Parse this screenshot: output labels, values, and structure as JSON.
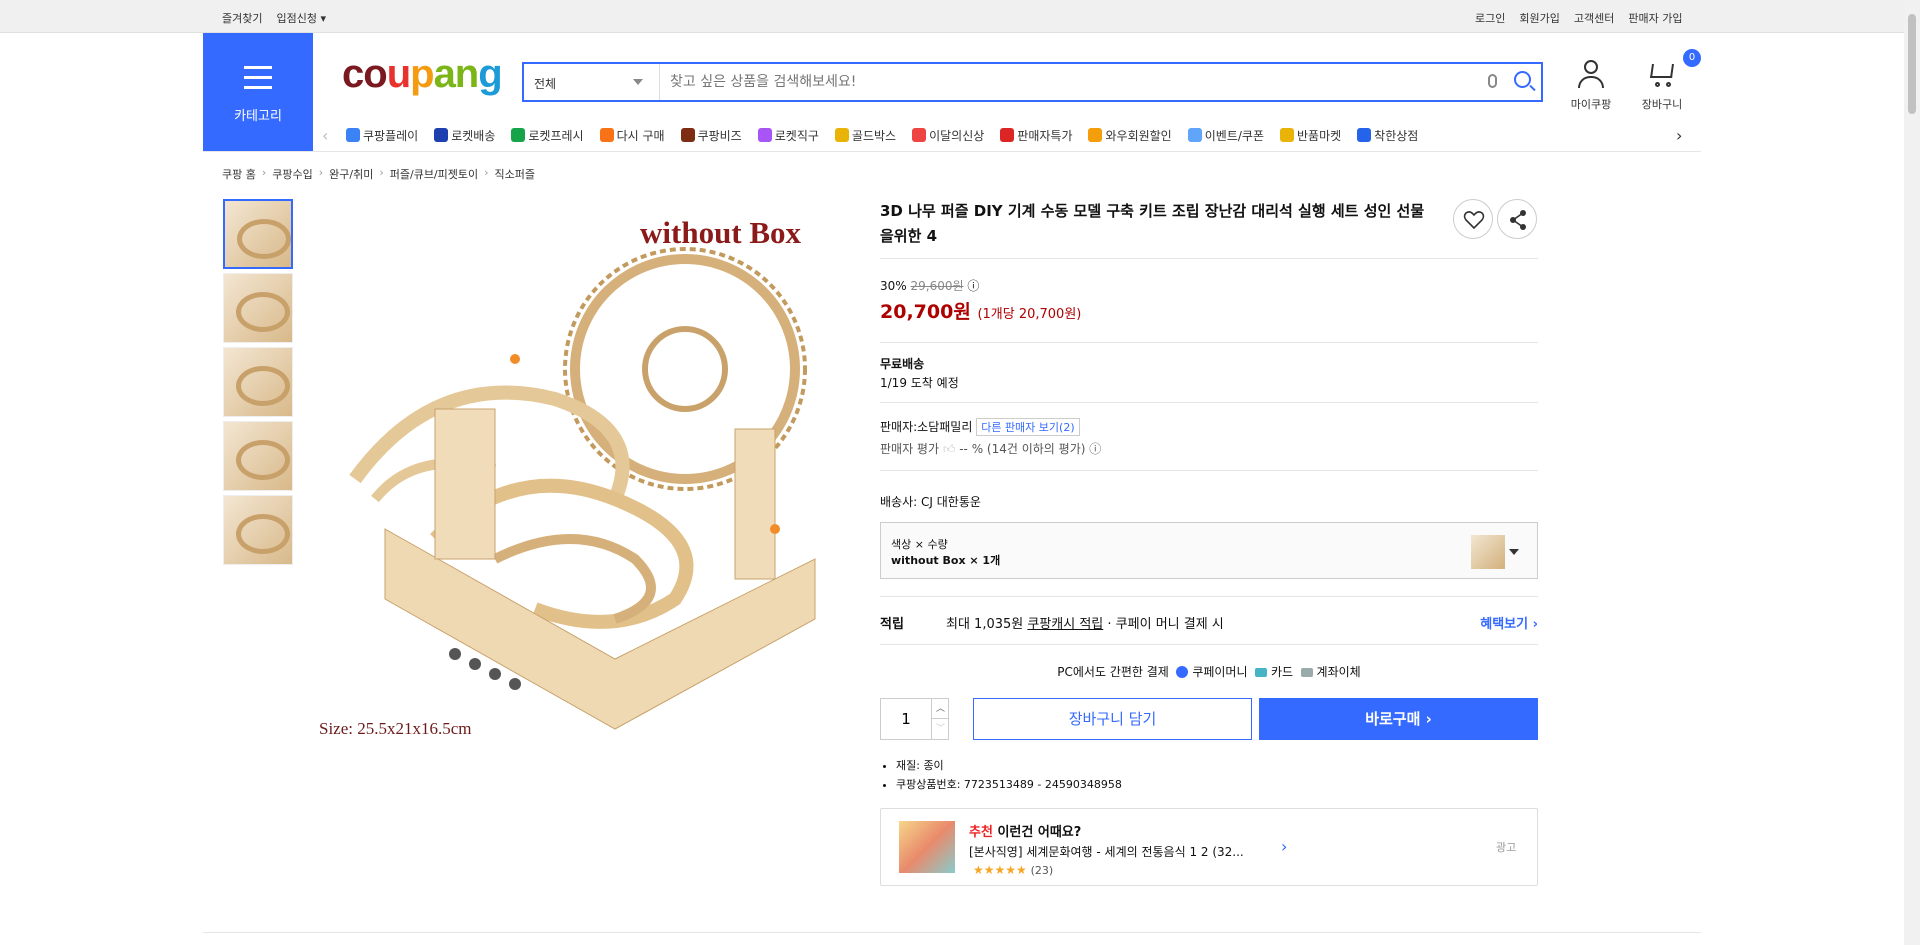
{
  "topbar": {
    "favorites": "즐겨찾기",
    "apply": "입점신청",
    "login": "로그인",
    "signup": "회원가입",
    "support": "고객센터",
    "seller_signup": "판매자 가입"
  },
  "category_button": "카테고리",
  "logo": {
    "p1": "co",
    "p2": "u",
    "p3": "p",
    "p4": "an",
    "p5": "g"
  },
  "search": {
    "category": "전체",
    "placeholder": "찾고 싶은 상품을 검색해보세요!"
  },
  "my_coupang": "마이쿠팡",
  "cart": {
    "label": "장바구니",
    "count": "0"
  },
  "nav_items": [
    {
      "label": "쿠팡플레이",
      "color": "#3b82f6"
    },
    {
      "label": "로켓배송",
      "color": "#1e40af"
    },
    {
      "label": "로켓프레시",
      "color": "#16a34a"
    },
    {
      "label": "다시 구매",
      "color": "#f97316"
    },
    {
      "label": "쿠팡비즈",
      "color": "#7c2d12"
    },
    {
      "label": "로켓직구",
      "color": "#a855f7"
    },
    {
      "label": "골드박스",
      "color": "#eab308"
    },
    {
      "label": "이달의신상",
      "color": "#ef4444"
    },
    {
      "label": "판매자특가",
      "color": "#dc2626"
    },
    {
      "label": "와우회원할인",
      "color": "#f59e0b"
    },
    {
      "label": "이벤트/쿠폰",
      "color": "#60a5fa"
    },
    {
      "label": "반품마켓",
      "color": "#eab308"
    },
    {
      "label": "착한상점",
      "color": "#2563eb"
    }
  ],
  "breadcrumb": [
    "쿠팡 홈",
    "쿠팡수입",
    "완구/취미",
    "퍼즐/큐브/피젯토이",
    "직소퍼즐"
  ],
  "main_image": {
    "overlay_text": "without Box",
    "size_text": "Size: 25.5x21x16.5cm"
  },
  "product": {
    "title": "3D 나무 퍼즐 DIY 기계 수동 모델 구축 키트 조립 장난감 대리석 실행 세트 성인 선물을위한 4",
    "discount": "30%",
    "original_price": "29,600원",
    "price": "20,700원",
    "unit_price": "(1개당 20,700원)",
    "shipping_title": "무료배송",
    "arrival": "1/19 도착 예정",
    "seller_label": "판매자:",
    "seller_name": "소담패밀리",
    "other_sellers": "다른 판매자 보기(2)",
    "seller_rating_label": "판매자 평가",
    "seller_rating_value": "-- % (14건 이하의 평가)",
    "courier_label": "배송사:",
    "courier": "CJ 대한통운",
    "option_label": "색상 × 수량",
    "option_value": "without Box × 1개",
    "reward_label": "적립",
    "reward_prefix": "최대 1,035원",
    "reward_link": "쿠팡캐시 적립",
    "reward_suffix": "· 쿠페이 머니 결제 시",
    "benefit": "혜택보기 ›",
    "pay_note": "PC에서도 간편한 결제",
    "pay_money": "쿠페이머니",
    "pay_card": "카드",
    "pay_bank": "계좌이체",
    "quantity": "1",
    "add_cart": "장바구니 담기",
    "buy_now": "바로구매 ›",
    "material": "재질: 종이",
    "product_no": "쿠팡상품번호: 7723513489 - 24590348958"
  },
  "recommend": {
    "head_red": "추천",
    "head_rest": " 이런건 어때요?",
    "item": "[본사직영] 세계문화여행 - 세계의 전통음식 1 2 (32...",
    "stars": "★★★★★",
    "count": "(23)",
    "ad": "광고"
  }
}
